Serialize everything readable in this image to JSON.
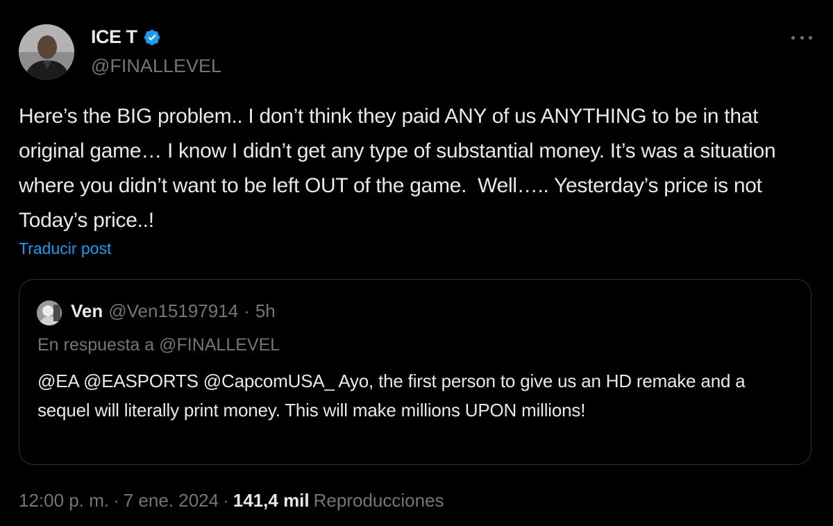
{
  "author": {
    "display_name": "ICE T",
    "handle": "@FINALLEVEL",
    "verified": true,
    "avatar_icon": "profile-photo"
  },
  "tweet": {
    "text": "Here’s the BIG problem.. I don’t think they paid ANY of us ANYTHING to be in that original game… I know I didn’t get any type of substantial money. It’s was a situation where you didn’t want to be left OUT of the game.  Well….. Yesterday’s price is not Today’s price..!",
    "translate_label": "Traducir post"
  },
  "quote": {
    "display_name": "Ven",
    "handle": "@Ven15197914",
    "separator": "·",
    "time": "5h",
    "reply_to": "En respuesta a @FINALLEVEL",
    "text": "@EA @EASPORTS @CapcomUSA_ Ayo, the first person to give us an HD remake and a sequel will literally print money. This will make millions UPON millions!"
  },
  "meta": {
    "time": "12:00 p. m.",
    "sep1": "·",
    "date": "7 ene. 2024",
    "sep2": "·",
    "views_count": "141,4 mil",
    "views_label": "Reproducciones"
  },
  "colors": {
    "background": "#000000",
    "primary_text": "#e7e9ea",
    "secondary_text": "#71767b",
    "link": "#1d9bf0",
    "border": "#2f3336",
    "verified_badge": "#1d9bf0"
  }
}
